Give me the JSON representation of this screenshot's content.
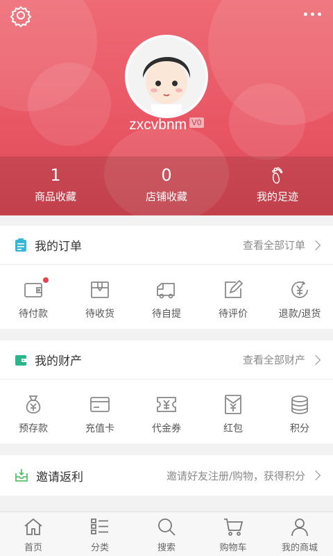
{
  "profile": {
    "username": "zxcvbnm",
    "level": "V0",
    "stats": [
      {
        "value": "1",
        "label": "商品收藏"
      },
      {
        "value": "0",
        "label": "店铺收藏"
      },
      {
        "label": "我的足迹",
        "icon": "footprint-icon"
      }
    ]
  },
  "orders": {
    "title": "我的订单",
    "more": "查看全部订单",
    "items": [
      {
        "label": "待付款",
        "icon": "wallet-icon",
        "badge": true
      },
      {
        "label": "待收货",
        "icon": "package-icon"
      },
      {
        "label": "待自提",
        "icon": "truck-icon"
      },
      {
        "label": "待评价",
        "icon": "edit-icon"
      },
      {
        "label": "退款/退货",
        "icon": "refund-icon"
      }
    ]
  },
  "assets": {
    "title": "我的财产",
    "more": "查看全部财产",
    "items": [
      {
        "label": "预存款",
        "icon": "money-bag-icon"
      },
      {
        "label": "充值卡",
        "icon": "card-icon"
      },
      {
        "label": "代金券",
        "icon": "voucher-icon"
      },
      {
        "label": "红包",
        "icon": "red-envelope-icon"
      },
      {
        "label": "积分",
        "icon": "coins-icon"
      }
    ]
  },
  "invite": {
    "title": "邀请返利",
    "desc": "邀请好友注册/购物，获得积分"
  },
  "tabbar": [
    {
      "label": "首页",
      "icon": "home-icon"
    },
    {
      "label": "分类",
      "icon": "category-icon"
    },
    {
      "label": "搜索",
      "icon": "search-icon"
    },
    {
      "label": "购物车",
      "icon": "cart-icon"
    },
    {
      "label": "我的商城",
      "icon": "user-icon"
    }
  ],
  "colors": {
    "brand": "#e85563",
    "order_icon": "#36b7d6",
    "asset_icon": "#2bb58b",
    "invite_icon": "#58c06a"
  }
}
